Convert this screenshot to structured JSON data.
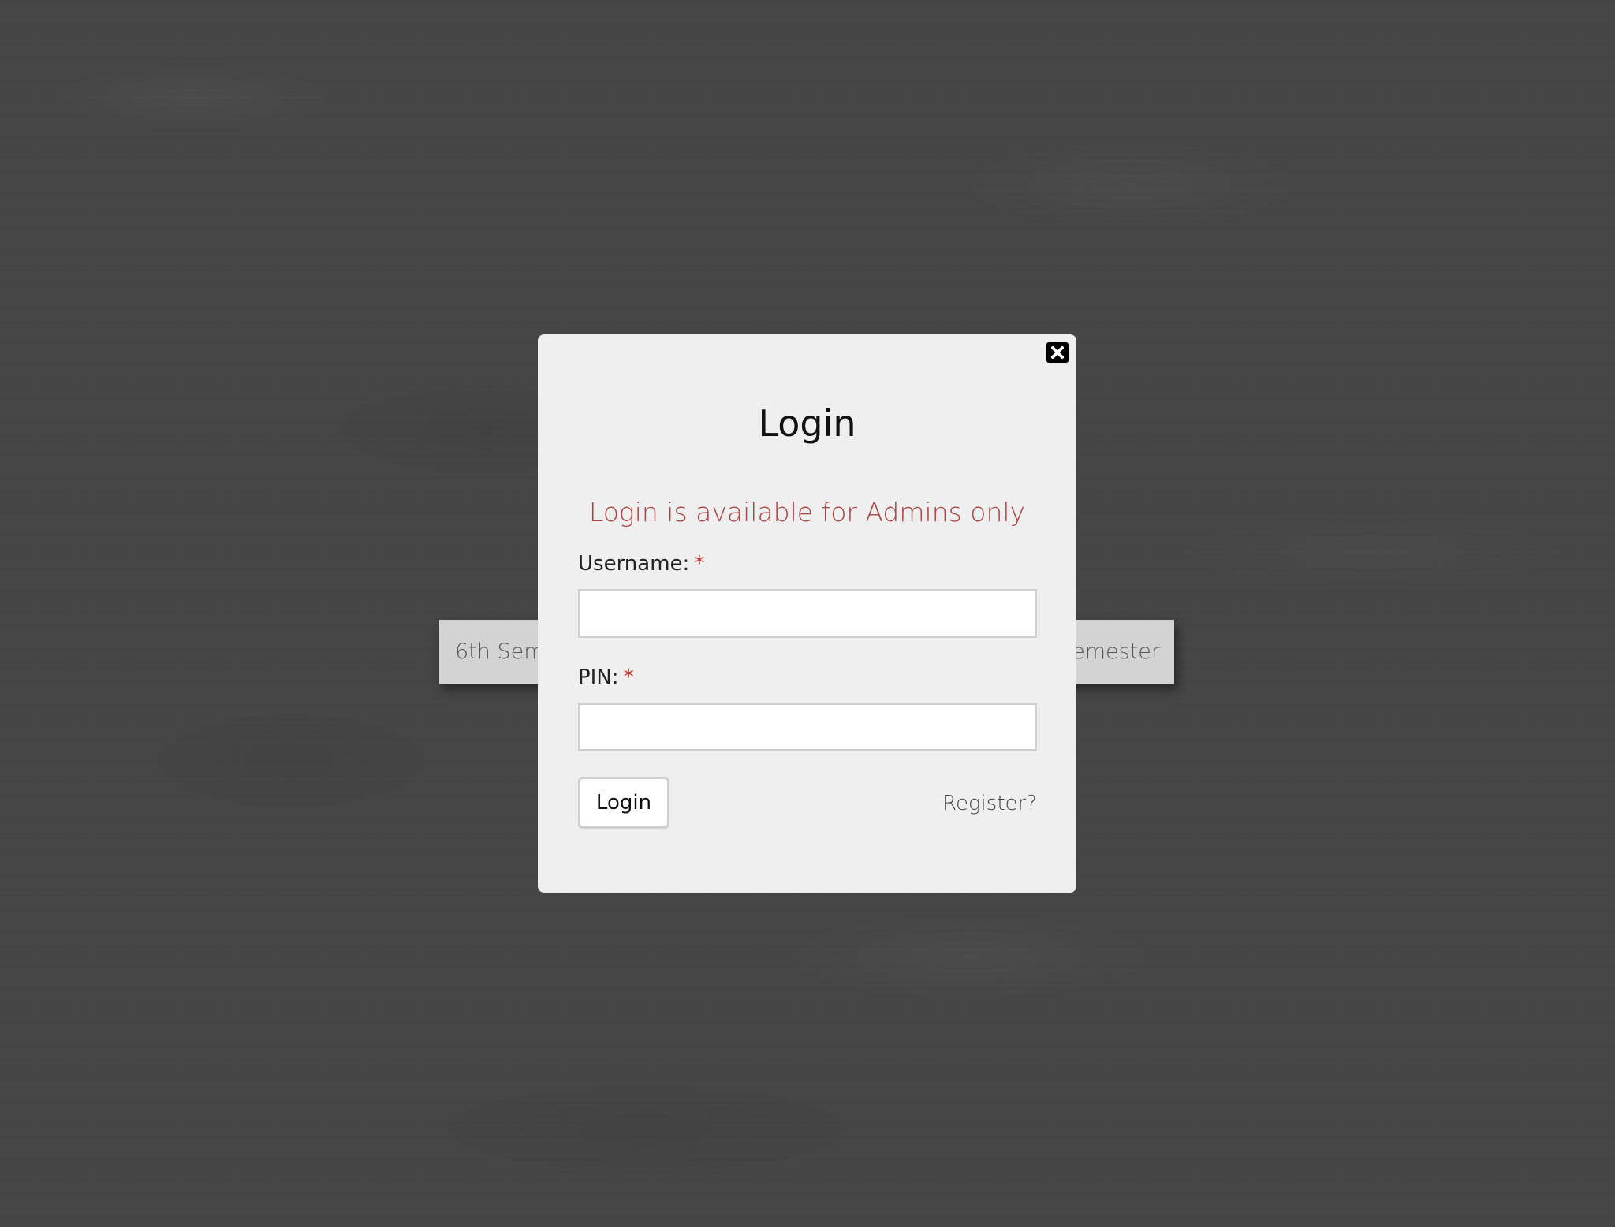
{
  "background": {
    "semester_left_label": "6th Semester",
    "semester_right_label": "7th Semester"
  },
  "modal": {
    "title": "Login",
    "notice": "Login is available for Admins only",
    "close_icon": "close-icon",
    "username_label": "Username:",
    "pin_label": "PIN:",
    "required_marker": "*",
    "username_value": "",
    "pin_value": "",
    "login_button_label": "Login",
    "register_link_label": "Register?"
  },
  "colors": {
    "notice": "#a94442",
    "required": "#c9302c",
    "modal_background": "#efefef",
    "page_background": "#454545"
  }
}
